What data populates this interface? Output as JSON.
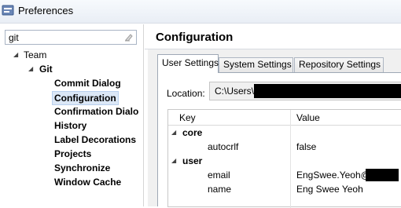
{
  "window": {
    "title": "Preferences"
  },
  "filter": {
    "value": "git"
  },
  "tree": {
    "team": "Team",
    "git": "Git",
    "items": [
      {
        "label": "Commit Dialog"
      },
      {
        "label": "Configuration"
      },
      {
        "label": "Confirmation Dialo"
      },
      {
        "label": "History"
      },
      {
        "label": "Label Decorations"
      },
      {
        "label": "Projects"
      },
      {
        "label": "Synchronize"
      },
      {
        "label": "Window Cache"
      }
    ]
  },
  "page": {
    "title": "Configuration"
  },
  "tabs": [
    {
      "label": "User Settings"
    },
    {
      "label": "System Settings"
    },
    {
      "label": "Repository Settings"
    }
  ],
  "location": {
    "label": "Location:",
    "value": "C:\\Users\\"
  },
  "table": {
    "headers": {
      "key": "Key",
      "value": "Value"
    },
    "sections": [
      {
        "name": "core",
        "entries": [
          {
            "key": "autocrlf",
            "value": "false"
          }
        ]
      },
      {
        "name": "user",
        "entries": [
          {
            "key": "email",
            "value": "EngSwee.Yeoh@"
          },
          {
            "key": "name",
            "value": "Eng Swee Yeoh"
          }
        ]
      }
    ]
  },
  "colors": {
    "selection": "#dbe7f6",
    "redaction": "#000000"
  }
}
